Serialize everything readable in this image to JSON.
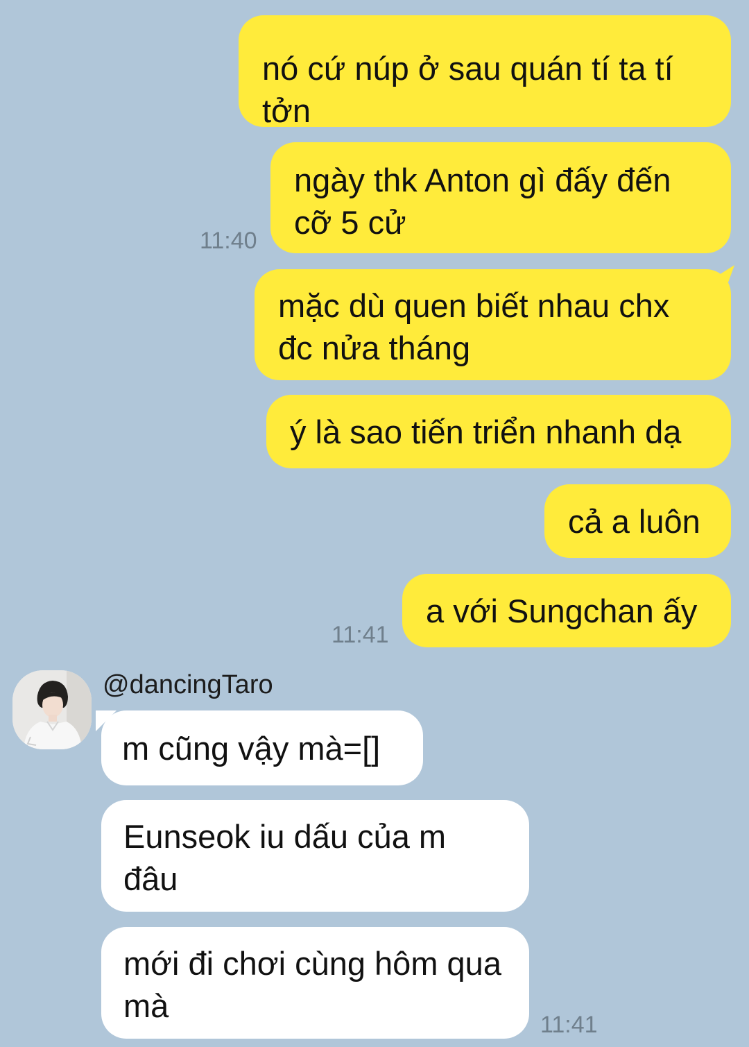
{
  "outgoing": [
    {
      "text": "nó cứ núp ở sau quán tí ta tí tởn"
    },
    {
      "text": "ngày thk Anton gì đấy đến cỡ 5 cử",
      "time": "11:40"
    },
    {
      "text": "mặc dù quen biết nhau chx đc nửa tháng"
    },
    {
      "text": "ý là sao tiến triển nhanh dạ"
    },
    {
      "text": "cả a luôn"
    },
    {
      "text": "a với Sungchan ấy",
      "time": "11:41"
    }
  ],
  "incoming": {
    "sender": "@dancingTaro",
    "messages": [
      {
        "text": "m cũng vậy mà=[]"
      },
      {
        "text": "Eunseok iu dấu của m đâu"
      },
      {
        "text": "mới đi chơi cùng hôm qua mà",
        "time": "11:41"
      }
    ]
  },
  "colors": {
    "background": "#b0c6d9",
    "outgoing_bubble": "#ffeb3b",
    "incoming_bubble": "#ffffff",
    "timestamp": "#6f7f8c"
  },
  "icons": {
    "avatar": "avatar-photo"
  }
}
